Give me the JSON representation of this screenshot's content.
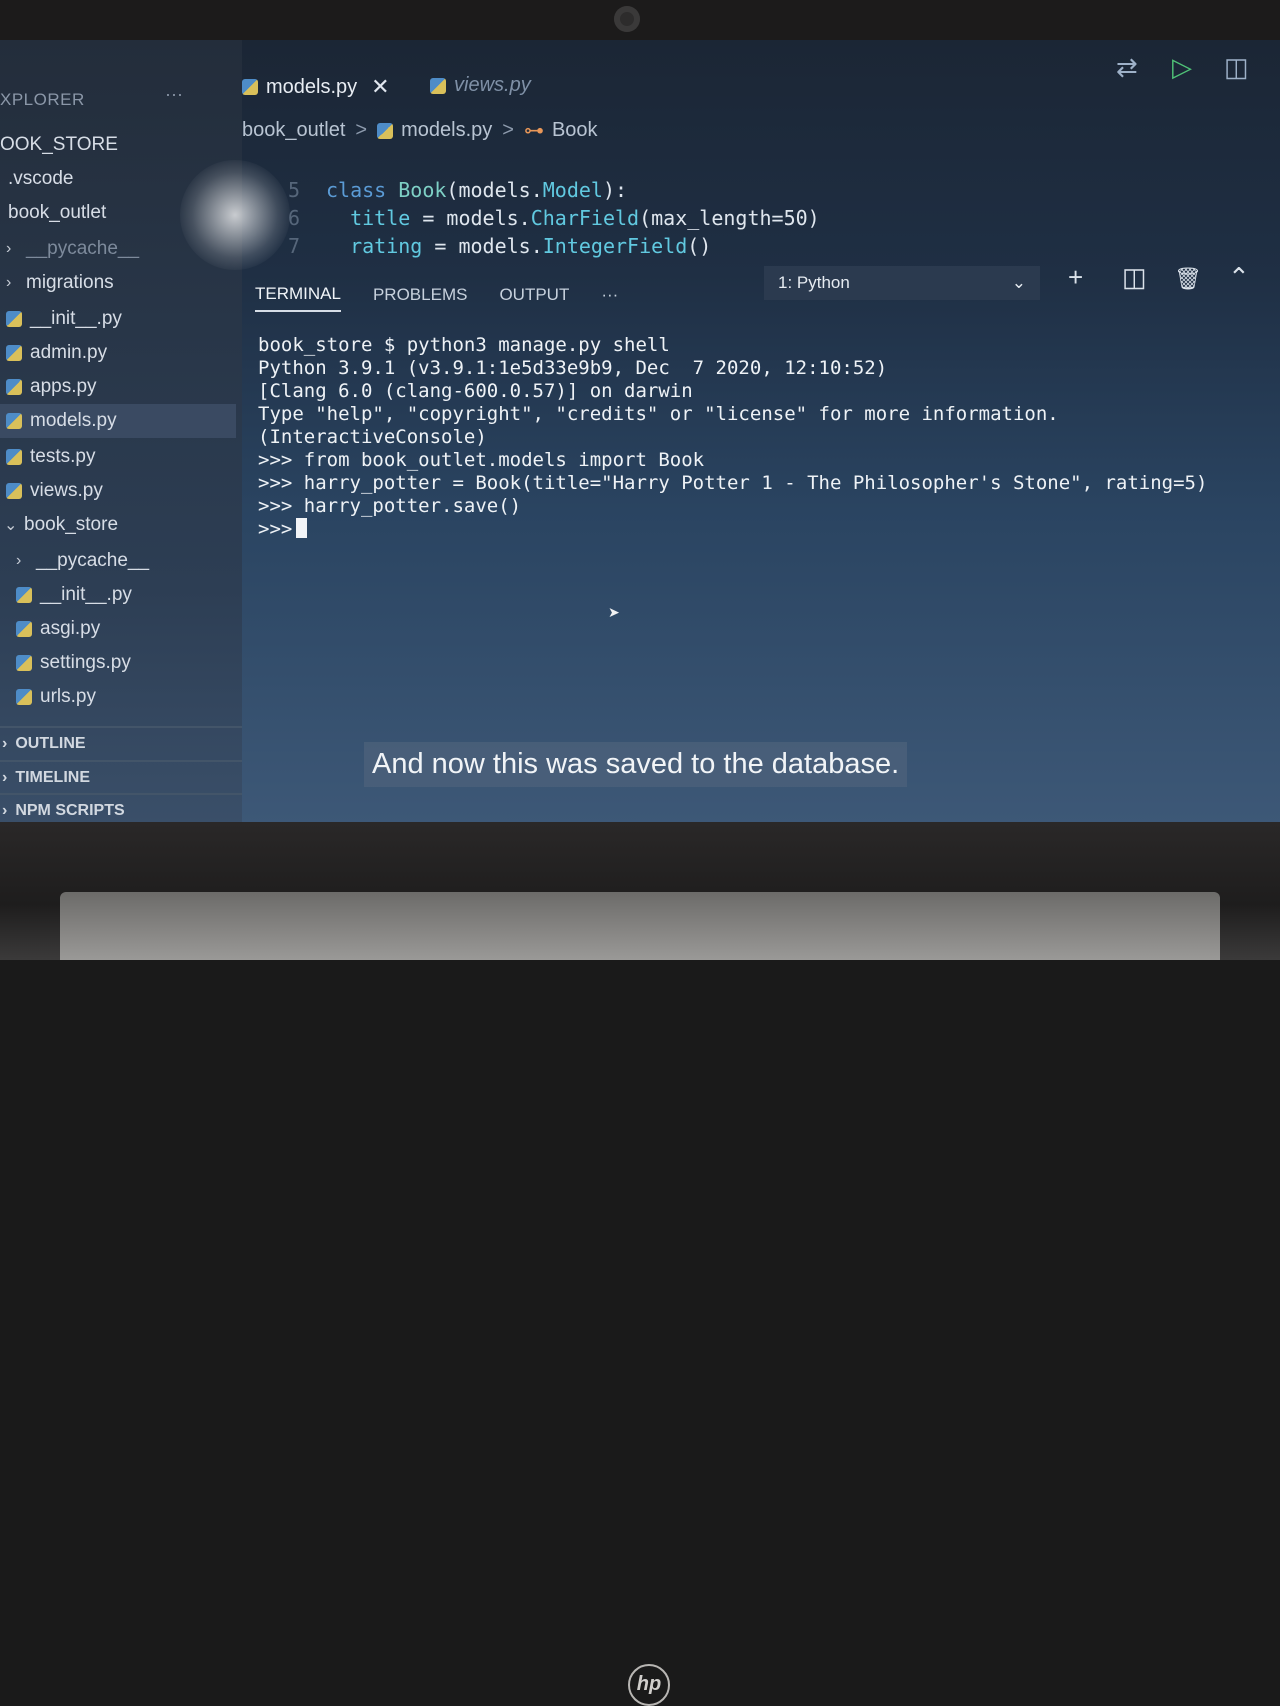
{
  "sidebar": {
    "title": "XPLORER",
    "more": "···",
    "items": [
      {
        "label": "OOK_STORE",
        "chev": "",
        "icon": false
      },
      {
        "label": ".vscode",
        "chev": "",
        "icon": false
      },
      {
        "label": "book_outlet",
        "chev": "",
        "icon": false
      },
      {
        "label": "__pycache__",
        "chev": "›",
        "icon": false
      },
      {
        "label": "migrations",
        "chev": "›",
        "icon": false
      },
      {
        "label": "__init__.py",
        "chev": "",
        "icon": true
      },
      {
        "label": "admin.py",
        "chev": "",
        "icon": true
      },
      {
        "label": "apps.py",
        "chev": "",
        "icon": true
      },
      {
        "label": "models.py",
        "chev": "",
        "icon": true
      },
      {
        "label": "tests.py",
        "chev": "",
        "icon": true
      },
      {
        "label": "views.py",
        "chev": "",
        "icon": true
      },
      {
        "label": "book_store",
        "chev": "⌄",
        "icon": false
      },
      {
        "label": "__pycache__",
        "chev": "›",
        "icon": false
      },
      {
        "label": "__init__.py",
        "chev": "",
        "icon": true
      },
      {
        "label": "asgi.py",
        "chev": "",
        "icon": true
      },
      {
        "label": "settings.py",
        "chev": "",
        "icon": true
      },
      {
        "label": "urls.py",
        "chev": "",
        "icon": true
      }
    ],
    "sections": [
      "OUTLINE",
      "TIMELINE",
      "NPM SCRIPTS"
    ]
  },
  "tabs": [
    {
      "label": "models.py",
      "active": true,
      "close": "✕"
    },
    {
      "label": "views.py",
      "active": false
    }
  ],
  "breadcrumb": {
    "folder": "book_outlet",
    "file": "models.py",
    "symbol": "Book",
    "sep": ">"
  },
  "code": {
    "lines": [
      {
        "num": "5",
        "kw": "class ",
        "name": "Book",
        "rest": "(models.",
        "fn": "Model",
        "end": "):"
      },
      {
        "num": "6",
        "kw": "  title",
        "name": " = models.",
        "rest": "",
        "fn": "CharField",
        "end": "(max_length=50)"
      },
      {
        "num": "7",
        "kw": "  rating",
        "name": " = models.",
        "rest": "",
        "fn": "IntegerField",
        "end": "()"
      }
    ]
  },
  "panel": {
    "tabs": [
      "TERMINAL",
      "PROBLEMS",
      "OUTPUT"
    ],
    "more": "···",
    "terminal_select": "1: Python",
    "select_arrow": "⌄"
  },
  "terminal": {
    "lines": [
      "book_store $ python3 manage.py shell",
      "Python 3.9.1 (v3.9.1:1e5d33e9b9, Dec  7 2020, 12:10:52)",
      "[Clang 6.0 (clang-600.0.57)] on darwin",
      "Type \"help\", \"copyright\", \"credits\" or \"license\" for more information.",
      "(InteractiveConsole)",
      ">>> from book_outlet.models import Book",
      ">>> harry_potter = Book(title=\"Harry Potter 1 - The Philosopher's Stone\", rating=5)",
      ">>> harry_potter.save()"
    ],
    "prompt": ">>>"
  },
  "caption": "And now this was saved to the database.",
  "icons": {
    "source_control": "⇄",
    "run": "▷",
    "split": "◫",
    "add": "+",
    "trash": "🗑",
    "collapse": "⌃"
  },
  "bezel": {
    "logo": "hp"
  }
}
